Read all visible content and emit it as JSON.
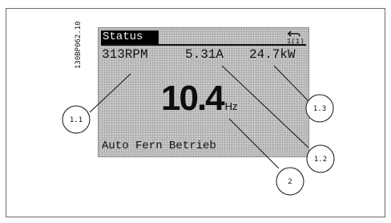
{
  "doc_code": "130BP062.10",
  "display": {
    "status_label": "Status",
    "menu_indicator": "1(1)",
    "readouts": [
      {
        "value": "313RPM"
      },
      {
        "value": "5.31A"
      },
      {
        "value": "24.7kW"
      }
    ],
    "main_reading": {
      "value": "10.4",
      "unit": "Hz"
    },
    "operating_mode": "Auto Fern Betrieb"
  },
  "callouts": [
    {
      "label": "1.1"
    },
    {
      "label": "1.2"
    },
    {
      "label": "1.3"
    },
    {
      "label": "2"
    }
  ],
  "colors": {
    "lcd_background": "#c7c7c7",
    "lcd_text": "#111111",
    "status_bar": "#000000"
  }
}
